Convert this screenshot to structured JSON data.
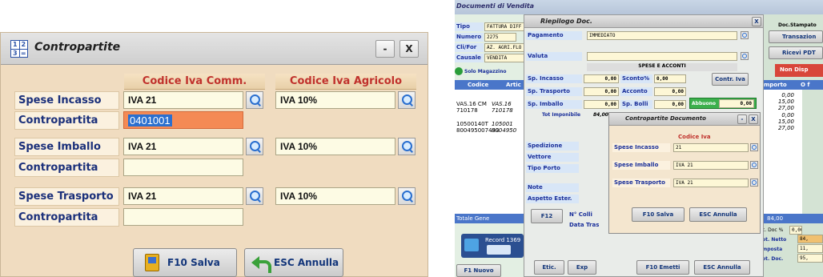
{
  "left": {
    "title": "Contropartite",
    "win_minimize": "-",
    "win_close": "X",
    "col_comm": "Codice Iva Comm.",
    "col_agri": "Codice Iva Agricolo",
    "rows": [
      {
        "label": "Spese Incasso",
        "comm": "IVA 21",
        "agri": "IVA 10%",
        "contro_label": "Contropartita",
        "contro_value": "0401001"
      },
      {
        "label": "Spese Imballo",
        "comm": "IVA 21",
        "agri": "IVA 10%",
        "contro_label": "Contropartita",
        "contro_value": ""
      },
      {
        "label": "Spese Trasporto",
        "comm": "IVA 21",
        "agri": "IVA 10%",
        "contro_label": "Contropartita",
        "contro_value": ""
      }
    ],
    "save_label": "F10 Salva",
    "cancel_label": "ESC Annulla"
  },
  "right": {
    "bg_title": "Documenti di Vendita",
    "bg_fields": [
      {
        "label": "Tipo",
        "value": "FATTURA DIFF"
      },
      {
        "label": "Numero",
        "value": "2275"
      },
      {
        "label": "Cli/For",
        "value": "AZ. AGRI.FLO"
      },
      {
        "label": "Causale",
        "value": "VENDITA"
      }
    ],
    "solo_magazzino": "Solo Magazzino",
    "col_codice": "Codice",
    "col_artic": "Artic",
    "codes": [
      "VAS.16 CM",
      "710178",
      "10500140T",
      "800495007493"
    ],
    "codes2": [
      "VAS.16",
      "710178",
      "105001",
      "8004950"
    ],
    "totale": "Totale Gene",
    "record": "Record 1369",
    "f1_nuovo": "F1 Nuovo",
    "doc_stampato": "Doc.Stampato",
    "transazione": "Transazion",
    "ricevi_pdt": "Ricevi PDT",
    "non_disp": "Non Disp",
    "importo_header": "mporto",
    "importo_o": "O f",
    "importi": [
      "0,00",
      "15,00",
      "27,00",
      "0,00",
      "15,00",
      "27,00"
    ],
    "tot_bottom": "84,00",
    "summary": [
      {
        "label": "c. Doc %",
        "value": "0,00"
      },
      {
        "label": "ot. Netto",
        "value": "84,"
      },
      {
        "label": "mposta",
        "value": "11,"
      },
      {
        "label": "ot. Doc.",
        "value": "95,"
      }
    ],
    "riepilogo": {
      "title": "Riepilogo Doc.",
      "close": "X",
      "pagamento_label": "Pagamento",
      "pagamento_value": "IMMEDIATO",
      "valuta_label": "Valuta",
      "spese_header": "SPESE E ACCONTI",
      "rows": [
        {
          "l1": "Sp. Incasso",
          "v1": "0,00",
          "l2": "Sconto%",
          "v2": "0,00"
        },
        {
          "l1": "Sp. Trasporto",
          "v1": "0,00",
          "l2": "Acconto",
          "v2": "0,00"
        },
        {
          "l1": "Sp. Imballo",
          "v1": "0,00",
          "l2": "Sp. Bolli",
          "v2": "0,00"
        }
      ],
      "contr_iva": "Contr. Iva",
      "abbuono_label": "Abbuono",
      "abbuono_value": "0,00",
      "tot_imponibile_label": "Tot Imponibile",
      "tot_imponibile_value": "84,00",
      "side_labels": [
        "Spedizione",
        "Vettore",
        "Tipo Porto",
        "Note",
        "Aspetto Ester."
      ],
      "f12": "F12",
      "n_colli": "N° Colli",
      "data_tras": "Data Tras",
      "etic": "Etic.",
      "exp": "Exp",
      "f10_emetti": "F10 Emetti",
      "esc_annulla": "ESC Annulla"
    },
    "contro_doc": {
      "title": "Contropartite Documento",
      "close": "X",
      "minimize": "-",
      "col": "Codice Iva",
      "rows": [
        {
          "label": "Spese Incasso",
          "value": "21"
        },
        {
          "label": "Spese Imballo",
          "value": "IVA 21"
        },
        {
          "label": "Spese Trasporto",
          "value": "IVA 21"
        }
      ],
      "save": "F10 Salva",
      "cancel": "ESC Annulla"
    }
  }
}
